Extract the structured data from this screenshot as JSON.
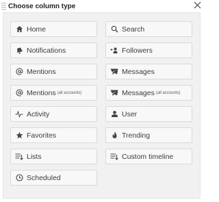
{
  "dialog": {
    "title": "Choose column type",
    "close_icon": "close-icon"
  },
  "columns": [
    {
      "label": "Home",
      "note": "",
      "icon": "home-icon"
    },
    {
      "label": "Search",
      "note": "",
      "icon": "search-icon"
    },
    {
      "label": "Notifications",
      "note": "",
      "icon": "bell-icon"
    },
    {
      "label": "Followers",
      "note": "",
      "icon": "add-user-icon"
    },
    {
      "label": "Mentions",
      "note": "",
      "icon": "at-icon"
    },
    {
      "label": "Messages",
      "note": "",
      "icon": "paper-plane-icon"
    },
    {
      "label": "Mentions",
      "note": "(all accounts)",
      "icon": "at-icon"
    },
    {
      "label": "Messages",
      "note": "(all accounts)",
      "icon": "paper-plane-icon"
    },
    {
      "label": "Activity",
      "note": "",
      "icon": "activity-icon"
    },
    {
      "label": "User",
      "note": "",
      "icon": "user-icon"
    },
    {
      "label": "Favorites",
      "note": "",
      "icon": "star-icon"
    },
    {
      "label": "Trending",
      "note": "",
      "icon": "flame-icon"
    },
    {
      "label": "Lists",
      "note": "",
      "icon": "list-icon"
    },
    {
      "label": "Custom timeline",
      "note": "",
      "icon": "custom-list-icon"
    },
    {
      "label": "Scheduled",
      "note": "",
      "icon": "clock-icon"
    }
  ]
}
